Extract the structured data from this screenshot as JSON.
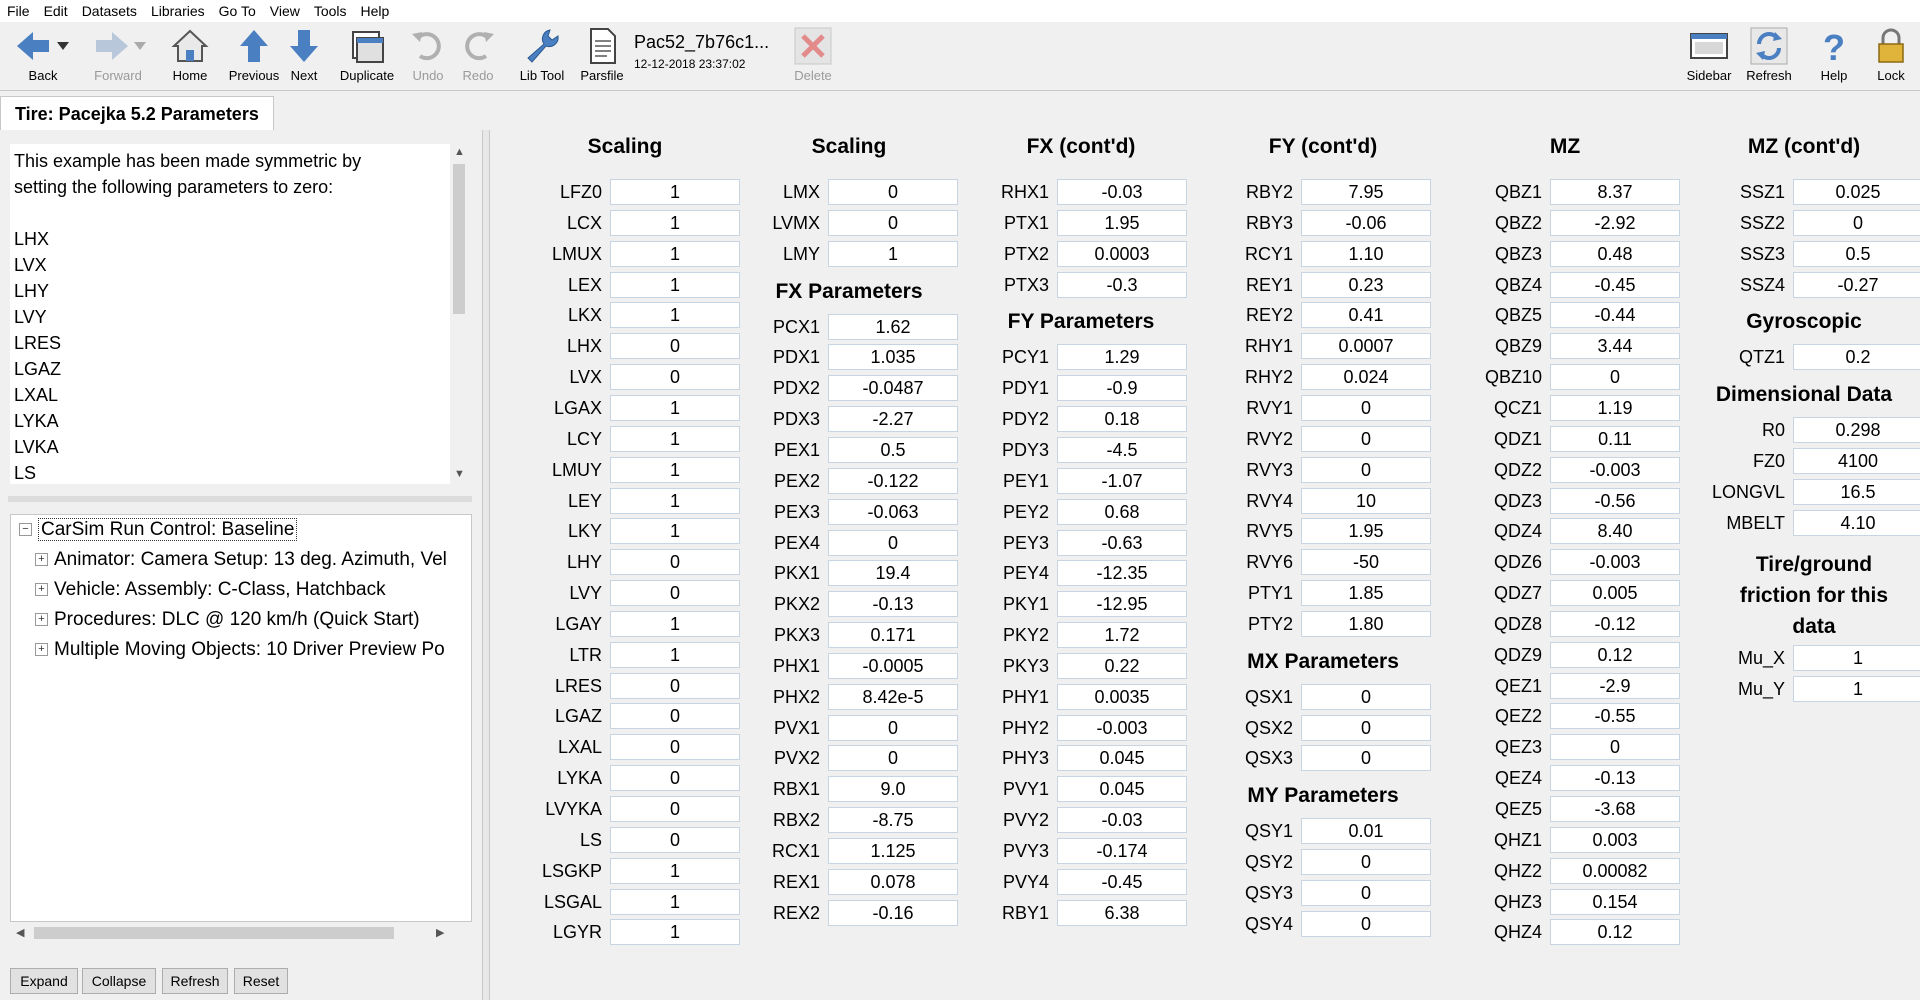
{
  "menu": [
    "File",
    "Edit",
    "Datasets",
    "Libraries",
    "Go To",
    "View",
    "Tools",
    "Help"
  ],
  "toolbar": {
    "back": "Back",
    "forward": "Forward",
    "home": "Home",
    "previous": "Previous",
    "next": "Next",
    "duplicate": "Duplicate",
    "undo": "Undo",
    "redo": "Redo",
    "lib_tool": "Lib Tool",
    "parsfile": "Parsfile",
    "parsfile_title": "Pac52_7b76c1...",
    "parsfile_date": "12-12-2018 23:37:02",
    "delete": "Delete",
    "sidebar": "Sidebar",
    "refresh": "Refresh",
    "help": "Help",
    "lock": "Lock"
  },
  "tab": {
    "title": "Tire: Pacejka 5.2 Parameters"
  },
  "notes": {
    "lines": [
      "This example has been made symmetric by",
      "setting the following parameters to zero:",
      "",
      "LHX",
      "LVX",
      "LHY",
      "LVY",
      "LRES",
      "LGAZ",
      "LXAL",
      "LYKA",
      "LVKA",
      "LS"
    ]
  },
  "tree": {
    "root": "CarSim Run Control: Baseline",
    "children": [
      "Animator: Camera Setup: 13 deg. Azimuth, Vel",
      "Vehicle: Assembly: C-Class, Hatchback",
      "Procedures: DLC @ 120 km/h (Quick Start)",
      "Multiple Moving Objects: 10 Driver Preview Po"
    ]
  },
  "bottom_buttons": {
    "expand": "Expand",
    "collapse": "Collapse",
    "refresh": "Refresh",
    "reset": "Reset"
  },
  "columns": [
    {
      "header": "Scaling",
      "groups": [
        {
          "rows": [
            [
              "LFZ0",
              "1"
            ],
            [
              "LCX",
              "1"
            ],
            [
              "LMUX",
              "1"
            ],
            [
              "LEX",
              "1"
            ],
            [
              "LKX",
              "1"
            ],
            [
              "LHX",
              "0"
            ],
            [
              "LVX",
              "0"
            ],
            [
              "LGAX",
              "1"
            ],
            [
              "LCY",
              "1"
            ],
            [
              "LMUY",
              "1"
            ],
            [
              "LEY",
              "1"
            ],
            [
              "LKY",
              "1"
            ],
            [
              "LHY",
              "0"
            ],
            [
              "LVY",
              "0"
            ],
            [
              "LGAY",
              "1"
            ],
            [
              "LTR",
              "1"
            ],
            [
              "LRES",
              "0"
            ],
            [
              "LGAZ",
              "0"
            ],
            [
              "LXAL",
              "0"
            ],
            [
              "LYKA",
              "0"
            ],
            [
              "LVYKA",
              "0"
            ],
            [
              "LS",
              "0"
            ],
            [
              "LSGKP",
              "1"
            ],
            [
              "LSGAL",
              "1"
            ],
            [
              "LGYR",
              "1"
            ]
          ]
        }
      ]
    },
    {
      "header": "Scaling",
      "groups": [
        {
          "rows": [
            [
              "LMX",
              "0"
            ],
            [
              "LVMX",
              "0"
            ],
            [
              "LMY",
              "1"
            ]
          ]
        },
        {
          "header": "FX Parameters",
          "rows": [
            [
              "PCX1",
              "1.62"
            ],
            [
              "PDX1",
              "1.035"
            ],
            [
              "PDX2",
              "-0.0487"
            ],
            [
              "PDX3",
              "-2.27"
            ],
            [
              "PEX1",
              "0.5"
            ],
            [
              "PEX2",
              "-0.122"
            ],
            [
              "PEX3",
              "-0.063"
            ],
            [
              "PEX4",
              "0"
            ],
            [
              "PKX1",
              "19.4"
            ],
            [
              "PKX2",
              "-0.13"
            ],
            [
              "PKX3",
              "0.171"
            ],
            [
              "PHX1",
              "-0.0005"
            ],
            [
              "PHX2",
              "8.42e-5"
            ],
            [
              "PVX1",
              "0"
            ],
            [
              "PVX2",
              "0"
            ],
            [
              "RBX1",
              "9.0"
            ],
            [
              "RBX2",
              "-8.75"
            ],
            [
              "RCX1",
              "1.125"
            ],
            [
              "REX1",
              "0.078"
            ],
            [
              "REX2",
              "-0.16"
            ]
          ]
        }
      ]
    },
    {
      "header": "FX (cont'd)",
      "groups": [
        {
          "rows": [
            [
              "RHX1",
              "-0.03"
            ],
            [
              "PTX1",
              "1.95"
            ],
            [
              "PTX2",
              "0.0003"
            ],
            [
              "PTX3",
              "-0.3"
            ]
          ]
        },
        {
          "header": "FY Parameters",
          "rows": [
            [
              "PCY1",
              "1.29"
            ],
            [
              "PDY1",
              "-0.9"
            ],
            [
              "PDY2",
              "0.18"
            ],
            [
              "PDY3",
              "-4.5"
            ],
            [
              "PEY1",
              "-1.07"
            ],
            [
              "PEY2",
              "0.68"
            ],
            [
              "PEY3",
              "-0.63"
            ],
            [
              "PEY4",
              "-12.35"
            ],
            [
              "PKY1",
              "-12.95"
            ],
            [
              "PKY2",
              "1.72"
            ],
            [
              "PKY3",
              "0.22"
            ],
            [
              "PHY1",
              "0.0035"
            ],
            [
              "PHY2",
              "-0.003"
            ],
            [
              "PHY3",
              "0.045"
            ],
            [
              "PVY1",
              "0.045"
            ],
            [
              "PVY2",
              "-0.03"
            ],
            [
              "PVY3",
              "-0.174"
            ],
            [
              "PVY4",
              "-0.45"
            ],
            [
              "RBY1",
              "6.38"
            ]
          ]
        }
      ]
    },
    {
      "header": "FY (cont'd)",
      "groups": [
        {
          "rows": [
            [
              "RBY2",
              "7.95"
            ],
            [
              "RBY3",
              "-0.06"
            ],
            [
              "RCY1",
              "1.10"
            ],
            [
              "REY1",
              "0.23"
            ],
            [
              "REY2",
              "0.41"
            ],
            [
              "RHY1",
              "0.0007"
            ],
            [
              "RHY2",
              "0.024"
            ],
            [
              "RVY1",
              "0"
            ],
            [
              "RVY2",
              "0"
            ],
            [
              "RVY3",
              "0"
            ],
            [
              "RVY4",
              "10"
            ],
            [
              "RVY5",
              "1.95"
            ],
            [
              "RVY6",
              "-50"
            ],
            [
              "PTY1",
              "1.85"
            ],
            [
              "PTY2",
              "1.80"
            ]
          ]
        },
        {
          "header": "MX Parameters",
          "rows": [
            [
              "QSX1",
              "0"
            ],
            [
              "QSX2",
              "0"
            ],
            [
              "QSX3",
              "0"
            ]
          ]
        },
        {
          "header": "MY Parameters",
          "rows": [
            [
              "QSY1",
              "0.01"
            ],
            [
              "QSY2",
              "0"
            ],
            [
              "QSY3",
              "0"
            ],
            [
              "QSY4",
              "0"
            ]
          ]
        }
      ]
    },
    {
      "header": "MZ",
      "groups": [
        {
          "rows": [
            [
              "QBZ1",
              "8.37"
            ],
            [
              "QBZ2",
              "-2.92"
            ],
            [
              "QBZ3",
              "0.48"
            ],
            [
              "QBZ4",
              "-0.45"
            ],
            [
              "QBZ5",
              "-0.44"
            ],
            [
              "QBZ9",
              "3.44"
            ],
            [
              "QBZ10",
              "0"
            ],
            [
              "QCZ1",
              "1.19"
            ],
            [
              "QDZ1",
              "0.11"
            ],
            [
              "QDZ2",
              "-0.003"
            ],
            [
              "QDZ3",
              "-0.56"
            ],
            [
              "QDZ4",
              "8.40"
            ],
            [
              "QDZ6",
              "-0.003"
            ],
            [
              "QDZ7",
              "0.005"
            ],
            [
              "QDZ8",
              "-0.12"
            ],
            [
              "QDZ9",
              "0.12"
            ],
            [
              "QEZ1",
              "-2.9"
            ],
            [
              "QEZ2",
              "-0.55"
            ],
            [
              "QEZ3",
              "0"
            ],
            [
              "QEZ4",
              "-0.13"
            ],
            [
              "QEZ5",
              "-3.68"
            ],
            [
              "QHZ1",
              "0.003"
            ],
            [
              "QHZ2",
              "0.00082"
            ],
            [
              "QHZ3",
              "0.154"
            ],
            [
              "QHZ4",
              "0.12"
            ]
          ]
        }
      ]
    },
    {
      "header": "MZ (cont'd)",
      "groups": [
        {
          "rows": [
            [
              "SSZ1",
              "0.025"
            ],
            [
              "SSZ2",
              "0"
            ],
            [
              "SSZ3",
              "0.5"
            ],
            [
              "SSZ4",
              "-0.27"
            ]
          ]
        },
        {
          "header": "Gyroscopic",
          "rows": [
            [
              "QTZ1",
              "0.2"
            ]
          ]
        },
        {
          "header": "Dimensional Data",
          "rows": [
            [
              "R0",
              "0.298"
            ],
            [
              "FZ0",
              "4100"
            ],
            [
              "LONGVL",
              "16.5"
            ],
            [
              "MBELT",
              "4.10"
            ]
          ]
        },
        {
          "header": "Tire/ground friction for this data",
          "rows": [
            [
              "Mu_X",
              "1"
            ],
            [
              "Mu_Y",
              "1"
            ]
          ]
        }
      ]
    }
  ]
}
